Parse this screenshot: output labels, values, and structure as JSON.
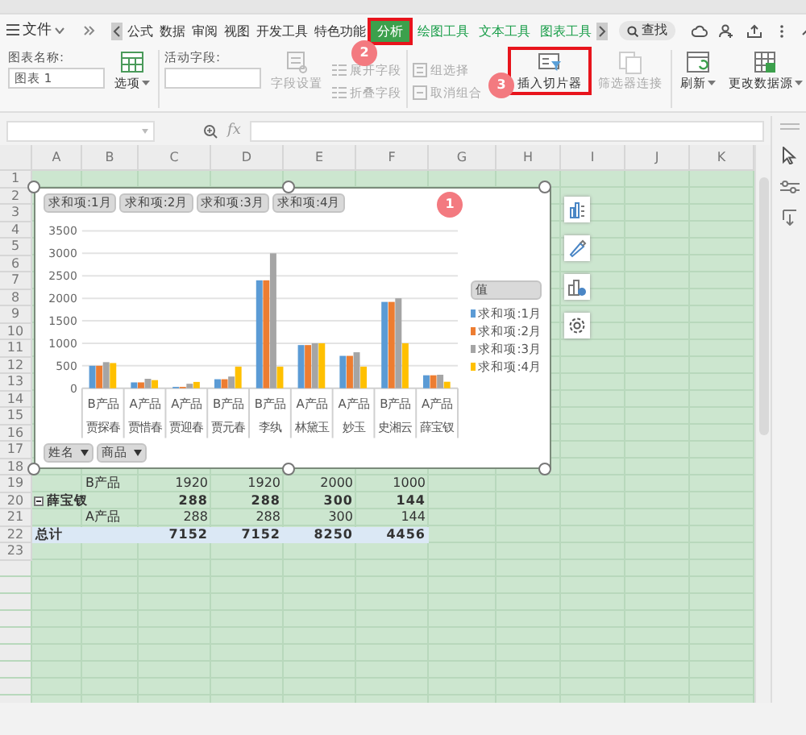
{
  "menu": {
    "file": "文件",
    "tabs": [
      {
        "label": "公式",
        "kind": "normal",
        "selected": false,
        "highlighted": false
      },
      {
        "label": "数据",
        "kind": "normal",
        "selected": false,
        "highlighted": false
      },
      {
        "label": "审阅",
        "kind": "normal",
        "selected": false,
        "highlighted": false
      },
      {
        "label": "视图",
        "kind": "normal",
        "selected": false,
        "highlighted": false
      },
      {
        "label": "开发工具",
        "kind": "normal",
        "selected": false,
        "highlighted": false
      },
      {
        "label": "特色功能",
        "kind": "normal",
        "selected": false,
        "highlighted": false
      },
      {
        "label": "分析",
        "kind": "normal",
        "selected": true,
        "highlighted": true
      },
      {
        "label": "绘图工具",
        "kind": "context",
        "selected": false,
        "highlighted": false
      },
      {
        "label": "文本工具",
        "kind": "context",
        "selected": false,
        "highlighted": false
      },
      {
        "label": "图表工具",
        "kind": "context",
        "selected": false,
        "highlighted": false
      }
    ],
    "search": "查找"
  },
  "ribbon": {
    "groups": [
      {
        "items": [
          {
            "kind": "field",
            "label": "图表名称:",
            "value": "图表 1"
          },
          {
            "kind": "large",
            "label": "选项",
            "disabled": false,
            "dropdown": true,
            "highlighted": false
          }
        ]
      },
      {
        "items": [
          {
            "kind": "field",
            "label": "活动字段:"
          },
          {
            "kind": "large",
            "label": "字段设置",
            "disabled": true,
            "dropdown": false,
            "highlighted": false
          },
          {
            "kind": "small",
            "label": "展开字段",
            "disabled": true,
            "dropdown": false,
            "highlighted": false
          },
          {
            "kind": "small",
            "label": "折叠字段",
            "disabled": true,
            "dropdown": false,
            "highlighted": false
          }
        ]
      },
      {
        "items": [
          {
            "kind": "small",
            "label": "组选择",
            "disabled": true,
            "dropdown": false,
            "highlighted": false
          },
          {
            "kind": "small",
            "label": "取消组合",
            "disabled": true,
            "dropdown": false,
            "highlighted": false
          },
          {
            "kind": "large",
            "label": "插入切片器",
            "disabled": false,
            "dropdown": false,
            "highlighted": true
          },
          {
            "kind": "large",
            "label": "筛选器连接",
            "disabled": true,
            "dropdown": false,
            "highlighted": false
          }
        ]
      },
      {
        "items": [
          {
            "kind": "large",
            "label": "刷新",
            "disabled": false,
            "dropdown": true,
            "highlighted": false
          },
          {
            "kind": "large",
            "label": "更改数据源",
            "disabled": false,
            "dropdown": true,
            "highlighted": false
          }
        ]
      }
    ]
  },
  "formula_bar": {
    "fx": "fx"
  },
  "sheet": {
    "columns": [
      "A",
      "B",
      "C",
      "D",
      "E",
      "F",
      "G",
      "H",
      "I",
      "J",
      "K"
    ],
    "rows": [
      {
        "number": "1"
      },
      {
        "number": "2"
      },
      {
        "number": "3"
      },
      {
        "number": "4"
      },
      {
        "number": "5"
      },
      {
        "number": "6"
      },
      {
        "number": "7"
      },
      {
        "number": "8"
      },
      {
        "number": "9"
      },
      {
        "number": "10"
      },
      {
        "number": "11"
      },
      {
        "number": "12"
      },
      {
        "number": "13"
      },
      {
        "number": "14"
      },
      {
        "number": "15"
      },
      {
        "number": "16"
      },
      {
        "number": "17"
      },
      {
        "number": "18"
      },
      {
        "number": "19",
        "kind": "item",
        "label": "B产品",
        "values": [
          "1920",
          "1920",
          "2000",
          "1000"
        ]
      },
      {
        "number": "20",
        "kind": "group",
        "label": "薛宝钗",
        "expanded": true,
        "values": [
          "288",
          "288",
          "300",
          "144"
        ]
      },
      {
        "number": "21",
        "kind": "item",
        "label": "A产品",
        "values": [
          "288",
          "288",
          "300",
          "144"
        ]
      },
      {
        "number": "22",
        "kind": "total",
        "label": "总计",
        "values": [
          "7152",
          "7152",
          "8250",
          "4456"
        ]
      },
      {
        "number": "23"
      }
    ]
  },
  "chart": {
    "field_buttons": [
      "求和项:1月",
      "求和项:2月",
      "求和项:3月",
      "求和项:4月"
    ],
    "legend_title": "值",
    "axis_buttons": [
      "姓名",
      "商品"
    ],
    "inner_axis_labels": [
      "B产品",
      "A产品",
      "A产品",
      "B产品",
      "B产品",
      "A产品",
      "A产品",
      "B产品",
      "A产品"
    ],
    "chart_data": {
      "type": "bar",
      "grid": true,
      "categories": [
        "贾探春",
        "贾惜春",
        "贾迎春",
        "贾元春",
        "李纨",
        "林黛玉",
        "妙玉",
        "史湘云",
        "薛宝钗"
      ],
      "ylim": [
        0,
        3500
      ],
      "yticks": [
        0,
        500,
        1000,
        1500,
        2000,
        2500,
        3000,
        3500
      ],
      "series": [
        {
          "name": "求和项:1月",
          "color": "#5b9bd5",
          "values": [
            500,
            130,
            30,
            200,
            2400,
            960,
            720,
            1920,
            288
          ]
        },
        {
          "name": "求和项:2月",
          "color": "#ed7d31",
          "values": [
            500,
            130,
            30,
            200,
            2400,
            960,
            720,
            1920,
            288
          ]
        },
        {
          "name": "求和项:3月",
          "color": "#a5a5a5",
          "values": [
            580,
            210,
            100,
            260,
            3000,
            1000,
            800,
            2000,
            300
          ]
        },
        {
          "name": "求和项:4月",
          "color": "#ffc000",
          "values": [
            560,
            180,
            140,
            480,
            480,
            1000,
            480,
            1000,
            144
          ]
        }
      ]
    }
  },
  "markers": [
    {
      "label": "1"
    },
    {
      "label": "2"
    },
    {
      "label": "3"
    }
  ]
}
